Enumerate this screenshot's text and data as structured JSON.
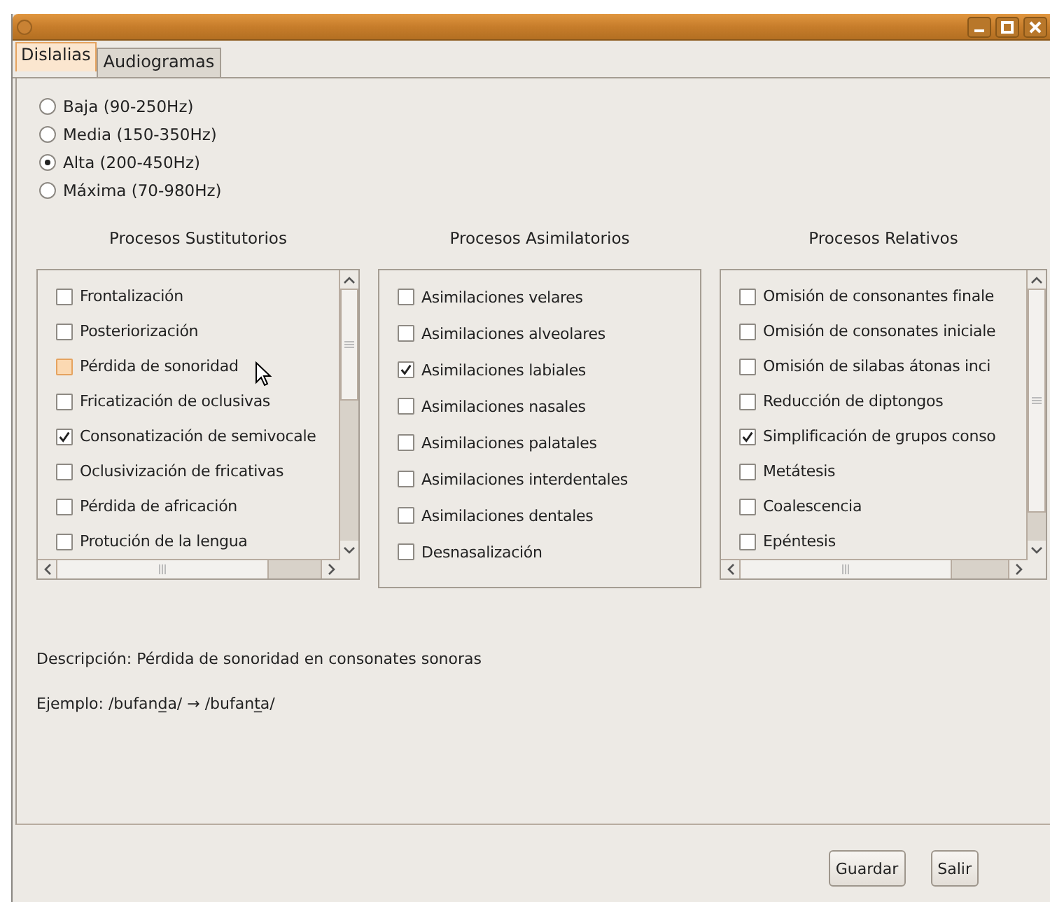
{
  "tabs": [
    {
      "label": "Dislalias",
      "selected": true
    },
    {
      "label": "Audiogramas",
      "selected": false
    }
  ],
  "frequency_options": [
    {
      "label": "Baja (90-250Hz)",
      "selected": false
    },
    {
      "label": "Media (150-350Hz)",
      "selected": false
    },
    {
      "label": "Alta (200-450Hz)",
      "selected": true
    },
    {
      "label": "Máxima (70-980Hz)",
      "selected": false
    }
  ],
  "process_groups": [
    {
      "title": "Procesos Sustitutorios",
      "scrollbars": true,
      "items": [
        {
          "label": "Frontalización",
          "checked": false,
          "hovered": false
        },
        {
          "label": "Posteriorización",
          "checked": false,
          "hovered": false
        },
        {
          "label": "Pérdida de sonoridad",
          "checked": false,
          "hovered": true
        },
        {
          "label": "Fricatización de oclusivas",
          "checked": false,
          "hovered": false
        },
        {
          "label": "Consonatización de semivocale",
          "checked": true,
          "hovered": false
        },
        {
          "label": "Oclusivización de fricativas",
          "checked": false,
          "hovered": false
        },
        {
          "label": "Pérdida de africación",
          "checked": false,
          "hovered": false
        },
        {
          "label": "Protución de la lengua",
          "checked": false,
          "hovered": false
        }
      ]
    },
    {
      "title": "Procesos Asimilatorios",
      "scrollbars": false,
      "items": [
        {
          "label": "Asimilaciones velares",
          "checked": false,
          "hovered": false
        },
        {
          "label": "Asimilaciones alveolares",
          "checked": false,
          "hovered": false
        },
        {
          "label": "Asimilaciones labiales",
          "checked": true,
          "hovered": false
        },
        {
          "label": "Asimilaciones nasales",
          "checked": false,
          "hovered": false
        },
        {
          "label": "Asimilaciones palatales",
          "checked": false,
          "hovered": false
        },
        {
          "label": "Asimilaciones interdentales",
          "checked": false,
          "hovered": false
        },
        {
          "label": "Asimilaciones dentales",
          "checked": false,
          "hovered": false
        },
        {
          "label": "Desnasalización",
          "checked": false,
          "hovered": false
        }
      ]
    },
    {
      "title": "Procesos Relativos",
      "scrollbars": true,
      "items": [
        {
          "label": "Omisión de consonantes finale",
          "checked": false,
          "hovered": false
        },
        {
          "label": "Omisión de consonates iniciale",
          "checked": false,
          "hovered": false
        },
        {
          "label": "Omisión de silabas átonas inci",
          "checked": false,
          "hovered": false
        },
        {
          "label": "Reducción de diptongos",
          "checked": false,
          "hovered": false
        },
        {
          "label": "Simplificación de grupos conso",
          "checked": true,
          "hovered": false
        },
        {
          "label": "Metátesis",
          "checked": false,
          "hovered": false
        },
        {
          "label": "Coalescencia",
          "checked": false,
          "hovered": false
        },
        {
          "label": "Epéntesis",
          "checked": false,
          "hovered": false
        }
      ]
    }
  ],
  "description": "Descripción: Pérdida de sonoridad en consonates sonoras",
  "example": "Ejemplo: /bufand̲a/ → /bufant̲a/",
  "buttons": [
    "Guardar",
    "Salir"
  ]
}
